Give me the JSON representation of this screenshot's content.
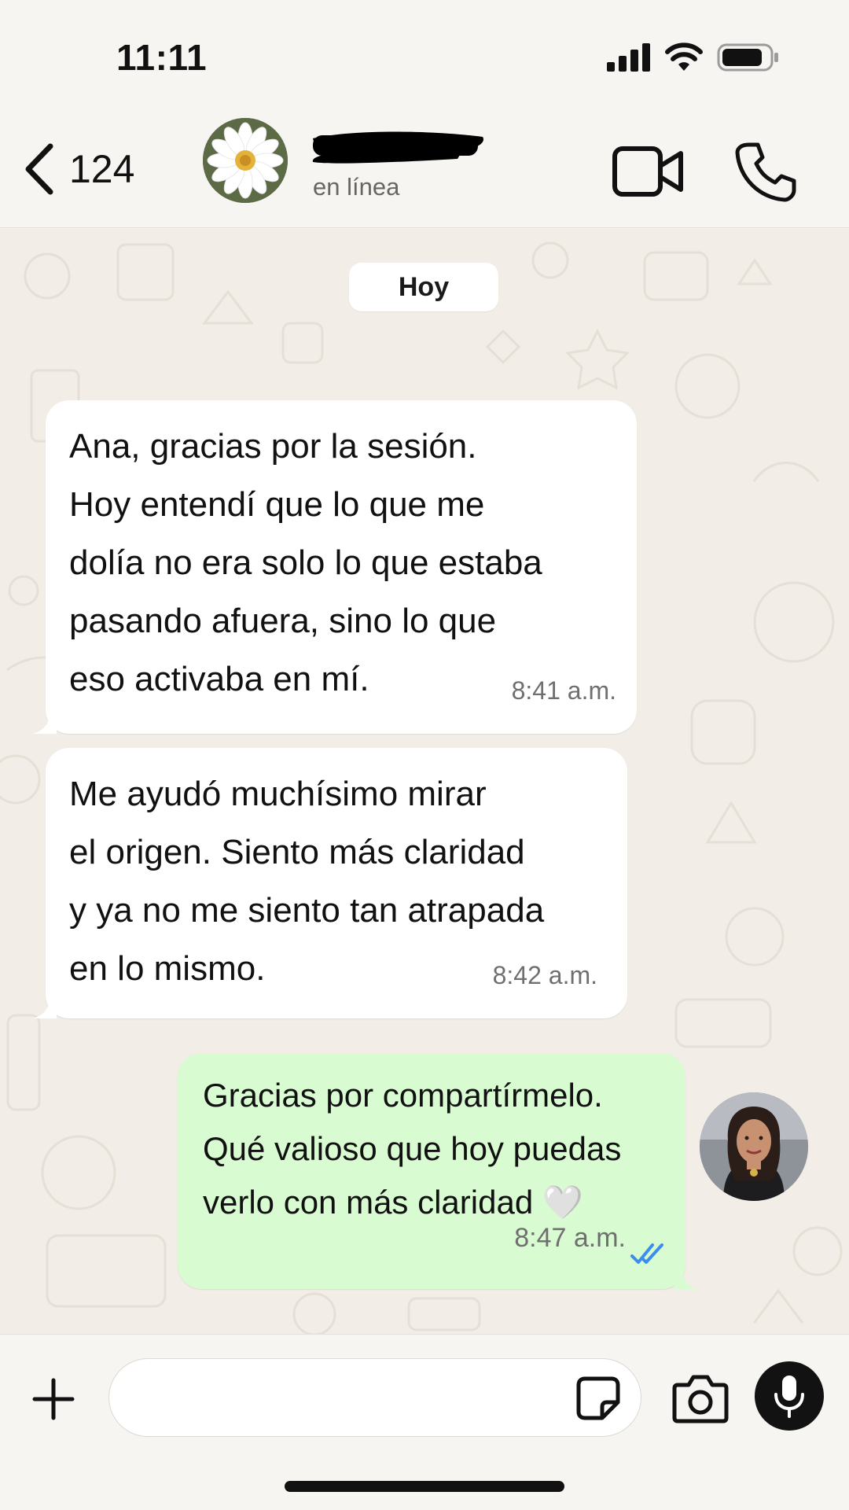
{
  "status_bar": {
    "time": "11:11"
  },
  "header": {
    "back_count": "124",
    "contact_status": "en línea",
    "contact_name_redacted": true
  },
  "chat": {
    "date_label": "Hoy",
    "messages": [
      {
        "direction": "incoming",
        "text": "Ana, gracias por la sesión.\nHoy entendí que lo que me\ndolía no era solo lo que estaba\npasando afuera, sino lo que\neso activaba en mí.",
        "time": "8:41 a.m."
      },
      {
        "direction": "incoming",
        "text": "Me ayudó muchísimo mirar\nel origen. Siento más claridad\ny ya no me siento tan atrapada\nen lo mismo.",
        "time": "8:42 a.m."
      },
      {
        "direction": "outgoing",
        "text": "Gracias por compartírmelo.\nQué valioso que hoy puedas\nverlo con más claridad 🤍",
        "time": "8:47 a.m.",
        "status": "read"
      }
    ]
  },
  "input": {
    "value": "",
    "placeholder": ""
  },
  "icons": {
    "back": "chevron-left-icon",
    "video": "video-camera-icon",
    "call": "phone-icon",
    "add": "plus-icon",
    "sticker": "sticker-icon",
    "camera": "camera-icon",
    "mic": "microphone-icon"
  },
  "colors": {
    "outgoing_bubble": "#d9fbd1",
    "incoming_bubble": "#ffffff",
    "chat_background": "#f2ede6",
    "read_ticks": "#3a8ef0"
  }
}
